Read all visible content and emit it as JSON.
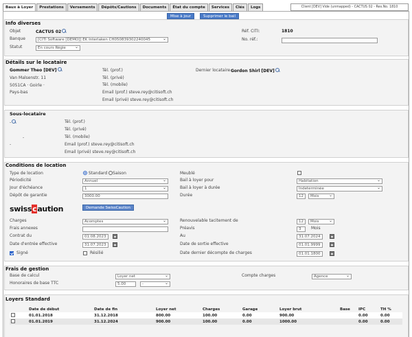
{
  "tabs": [
    {
      "label": "Baux à Loyer",
      "active": true
    },
    {
      "label": "Prestations"
    },
    {
      "label": "Versements"
    },
    {
      "label": "Dépôts/Cautions"
    },
    {
      "label": "Documents"
    },
    {
      "label": "État du compte"
    },
    {
      "label": "Services"
    },
    {
      "label": "Clés"
    },
    {
      "label": "Logs"
    }
  ],
  "client_info": "Client [DEV] Vide (unmapped) - CACTUS 02 - Res.No. 1810",
  "actions": {
    "update": "Mise à jour",
    "delete": "Supprimer le bail"
  },
  "info": {
    "title": "Info diverses",
    "object_label": "Objet",
    "object_value": "CACTUS 02",
    "bank_label": "Banque",
    "bank_value": "[CITI Software [DEMO]] EK Interlaken CH050839302240045",
    "status_label": "Statut",
    "status_value": "En cours Régie",
    "ref_citi_label": "Réf. CITI:",
    "ref_citi_value": "1810",
    "ref_no_label": "No. réf.:",
    "ref_no_value": ""
  },
  "tenant": {
    "title": "Détails sur le locataire",
    "name": "Gommer Theo [DEV]",
    "street": "Van Malsenstr. 11",
    "city": "5051CA · Goirle ·",
    "country": "Pays-bas",
    "tel_prof": "Tél. (prof.)",
    "tel_priv": "Tél. (privé)",
    "tel_mob": "Tél. (mobile)",
    "email_prof": "Email (prof.) steve.rey@citisoft.ch",
    "email_priv": "Email (privé) steve.rey@citisoft.ch",
    "last_label": "Dernier locataire",
    "last_value": "Gordon Shirl [DEV]"
  },
  "sub": {
    "title": "Sous-locataire",
    "dash1": "-",
    "dash2": "-",
    "dash3": "-",
    "tel_prof": "Tél. (prof.)",
    "tel_priv": "Tél. (privé)",
    "tel_mob": "Tél. (mobile)",
    "email_prof": "Email (prof.) steve.rey@citisoft.ch",
    "email_priv": "Email (privé) steve.rey@citisoft.ch"
  },
  "cond": {
    "title": "Conditions de location",
    "type_label": "Type de location",
    "type_std": "Standard",
    "type_season": "Saison",
    "period_label": "Périodicité",
    "period_value": "Annuel",
    "due_label": "Jour d'échéance",
    "due_value": "1",
    "deposit_label": "Dépôt de garantie",
    "deposit_value": "3000.00",
    "logo_a": "swiss",
    "logo_b": "c",
    "logo_c": "aution",
    "swisscaution_btn": "Demande SwissCaution",
    "charges_label": "Charges",
    "charges_value": "Acomptes",
    "fees_label": "Frais annexes",
    "fees_value": "",
    "contract_label": "Contrat du",
    "contract_value": "01.08.2023",
    "entry_label": "Date d'entrée effective",
    "entry_value": "31.07.2023",
    "signed_label": "Signé",
    "cancelled_label": "Résilié",
    "furnished_label": "Meublé",
    "lease_for_label": "Bail à loyer pour",
    "lease_for_value": "Habitation",
    "duration_type_label": "Bail à loyer à durée",
    "duration_type_value": "Indeterminée",
    "duration_label": "Durée",
    "duration_num": "12",
    "duration_unit": "Mois",
    "renew_label": "Renouvelable tacitement de",
    "renew_num": "12",
    "renew_unit": "Mois",
    "notice_label": "Préavis",
    "notice_num": "3",
    "notice_unit": "Mois",
    "to_label": "Au",
    "to_value": "31.07.2024",
    "exit_label": "Date de sortie effective",
    "exit_value": "01.01.9999",
    "last_charges_label": "Date dernier décompte de charges",
    "last_charges_value": "01.01.1800"
  },
  "fees": {
    "title": "Frais de gestion",
    "base_label": "Base de calcul",
    "base_value": "Loyer net",
    "hon_label": "Honoraires de base TTC",
    "hon_value": "5.00",
    "hon_unit": "-",
    "account_label": "Compte charges",
    "account_value": "Agence"
  },
  "rents": {
    "title": "Loyers Standard",
    "headers": [
      "Date de début",
      "Date de fin",
      "Loyer net",
      "Charges",
      "Garage",
      "Loyer brut",
      "Base",
      "IPC",
      "TH %"
    ],
    "rows": [
      [
        "01.01.2018",
        "31.12.2018",
        "800.00",
        "100.00",
        "0.00",
        "900.00",
        "",
        "0.00",
        "0.00"
      ],
      [
        "01.01.2019",
        "31.12.2024",
        "900.00",
        "100.00",
        "0.00",
        "1000.00",
        "",
        "0.00",
        "0.00"
      ]
    ]
  }
}
